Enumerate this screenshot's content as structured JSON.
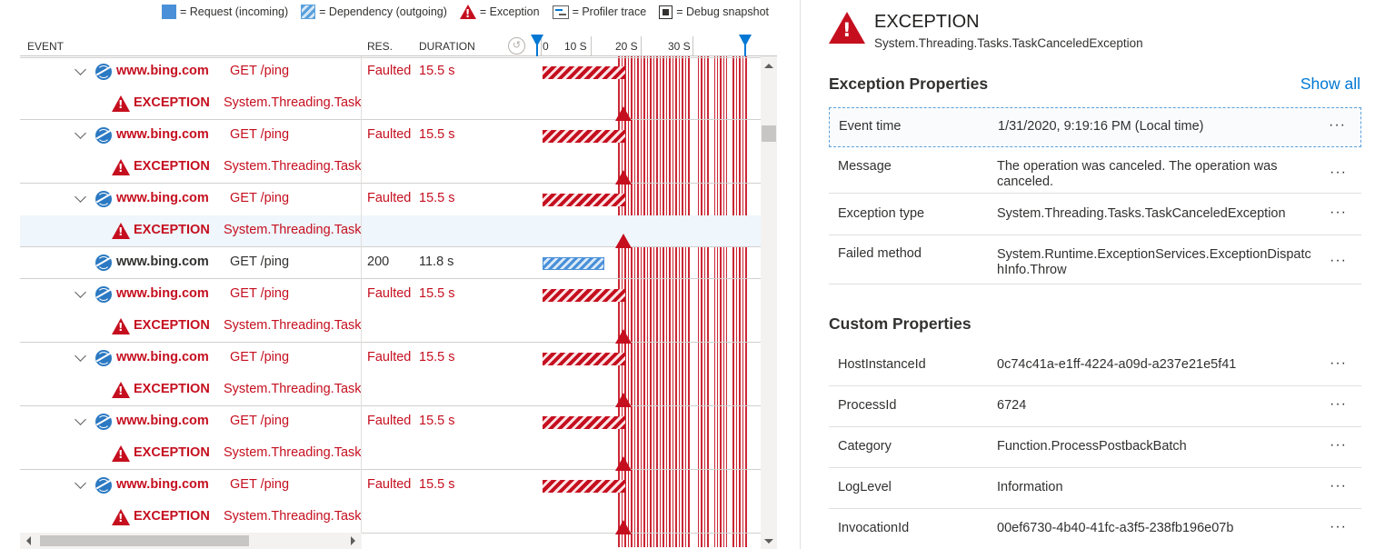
{
  "legend": {
    "request": "= Request (incoming)",
    "dependency": "= Dependency (outgoing)",
    "exception": "= Exception",
    "profiler": "= Profiler trace",
    "snapshot": "= Debug snapshot"
  },
  "header": {
    "event": "EVENT",
    "res": "RES.",
    "duration": "DURATION",
    "ticks": [
      "0",
      "10 S",
      "20 S",
      "30 S"
    ]
  },
  "rows": [
    {
      "kind": "dep",
      "host": "www.bing.com",
      "method": "GET /ping",
      "res": "Faulted",
      "duration": "15.5 s",
      "faulted": true
    },
    {
      "kind": "exc",
      "label": "EXCEPTION",
      "type": "System.Threading.Task"
    },
    {
      "kind": "dep",
      "host": "www.bing.com",
      "method": "GET /ping",
      "res": "Faulted",
      "duration": "15.5 s",
      "faulted": true
    },
    {
      "kind": "exc",
      "label": "EXCEPTION",
      "type": "System.Threading.Task"
    },
    {
      "kind": "dep",
      "host": "www.bing.com",
      "method": "GET /ping",
      "res": "Faulted",
      "duration": "15.5 s",
      "faulted": true
    },
    {
      "kind": "exc",
      "label": "EXCEPTION",
      "type": "System.Threading.Task",
      "selected": true
    },
    {
      "kind": "dep",
      "host": "www.bing.com",
      "method": "GET /ping",
      "res": "200",
      "duration": "11.8 s",
      "faulted": false
    },
    {
      "kind": "dep",
      "host": "www.bing.com",
      "method": "GET /ping",
      "res": "Faulted",
      "duration": "15.5 s",
      "faulted": true
    },
    {
      "kind": "exc",
      "label": "EXCEPTION",
      "type": "System.Threading.Task"
    },
    {
      "kind": "dep",
      "host": "www.bing.com",
      "method": "GET /ping",
      "res": "Faulted",
      "duration": "15.5 s",
      "faulted": true
    },
    {
      "kind": "exc",
      "label": "EXCEPTION",
      "type": "System.Threading.Task"
    },
    {
      "kind": "dep",
      "host": "www.bing.com",
      "method": "GET /ping",
      "res": "Faulted",
      "duration": "15.5 s",
      "faulted": true
    },
    {
      "kind": "exc",
      "label": "EXCEPTION",
      "type": "System.Threading.Task"
    },
    {
      "kind": "dep",
      "host": "www.bing.com",
      "method": "GET /ping",
      "res": "Faulted",
      "duration": "15.5 s",
      "faulted": true
    },
    {
      "kind": "exc",
      "label": "EXCEPTION",
      "type": "System.Threading.Task"
    }
  ],
  "panel": {
    "title": "EXCEPTION",
    "subtitle": "System.Threading.Tasks.TaskCanceledException",
    "exception_section": "Exception Properties",
    "show_all": "Show all",
    "exception_props": [
      {
        "key": "Event time",
        "value": "1/31/2020, 9:19:16 PM (Local time)"
      },
      {
        "key": "Message",
        "value": "The operation was canceled. The operation was canceled."
      },
      {
        "key": "Exception type",
        "value": "System.Threading.Tasks.TaskCanceledException"
      },
      {
        "key": "Failed method",
        "value": "System.Runtime.ExceptionServices.ExceptionDispatchInfo.Throw"
      }
    ],
    "custom_section": "Custom Properties",
    "custom_props": [
      {
        "key": "HostInstanceId",
        "value": "0c74c41a-e1ff-4224-a09d-a237e21e5f41"
      },
      {
        "key": "ProcessId",
        "value": "6724"
      },
      {
        "key": "Category",
        "value": "Function.ProcessPostbackBatch"
      },
      {
        "key": "LogLevel",
        "value": "Information"
      },
      {
        "key": "InvocationId",
        "value": "00ef6730-4b40-41fc-a3f5-238fb196e07b"
      }
    ],
    "more": "···"
  },
  "colors": {
    "error": "#c50f1f",
    "accent": "#0078d4",
    "request": "#4a90d9"
  }
}
